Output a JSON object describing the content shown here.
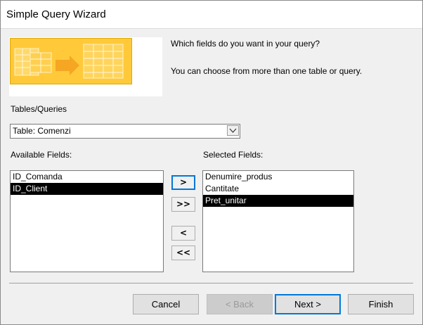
{
  "window": {
    "title": "Simple Query Wizard"
  },
  "instructions": {
    "question": "Which fields do you want in your query?",
    "hint": "You can choose from more than one table or query."
  },
  "tables_queries": {
    "label": "Tables/Queries",
    "selected": "Table: Comenzi"
  },
  "available_fields": {
    "label": "Available Fields:",
    "items": [
      "ID_Comanda",
      "ID_Client"
    ],
    "selected_index": 1
  },
  "selected_fields": {
    "label": "Selected Fields:",
    "items": [
      "Denumire_produs",
      "Cantitate",
      "Pret_unitar"
    ],
    "selected_index": 2
  },
  "move_buttons": {
    "add_one": ">",
    "add_all": ">>",
    "remove_one": "<",
    "remove_all": "<<"
  },
  "footer": {
    "cancel": "Cancel",
    "back": "< Back",
    "next": "Next >",
    "finish": "Finish"
  },
  "icons": {
    "banner": "query-wizard-illustration-icon",
    "dropdown": "chevron-down-icon"
  },
  "colors": {
    "banner": "#ffc93a",
    "focus": "#0078d7",
    "selection": "#000000"
  }
}
